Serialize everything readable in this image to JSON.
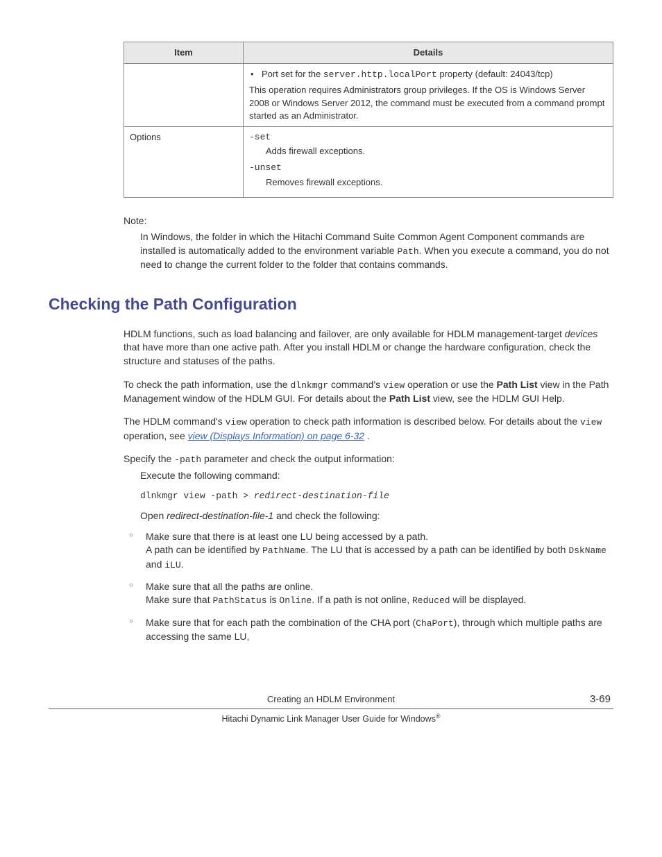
{
  "table": {
    "headers": {
      "item": "Item",
      "details": "Details"
    },
    "row1": {
      "bullet_pre": "Port set for the ",
      "bullet_code": "server.http.localPort",
      "bullet_post": " property (default: 24043/tcp)",
      "para": "This operation requires Administrators group privileges. If the OS is Windows Server 2008 or Windows Server 2012, the command must be executed from a command prompt started as an Administrator."
    },
    "row2": {
      "item": "Options",
      "opt1_code": "-set",
      "opt1_desc": "Adds firewall exceptions.",
      "opt2_code": "-unset",
      "opt2_desc": "Removes firewall exceptions."
    }
  },
  "note": {
    "label": "Note:",
    "body_pre": "In Windows, the folder in which the Hitachi Command Suite Common Agent Component commands are installed is automatically added to the environment variable ",
    "body_code": "Path",
    "body_post": ". When you execute a command, you do not need to change the current folder to the folder that contains commands."
  },
  "heading": "Checking the Path Configuration",
  "para1_pre": "HDLM functions, such as load balancing and failover, are only available for HDLM management-target ",
  "para1_em": "devices",
  "para1_post": " that have more than one active path. After you install HDLM or change the hardware configuration, check the structure and statuses of the paths.",
  "para2": {
    "t1": "To check the path information, use the ",
    "c1": "dlnkmgr",
    "t2": " command's ",
    "c2": "view",
    "t3": " operation or use the ",
    "b1": "Path List",
    "t4": " view in the Path Management window of the HDLM GUI. For details about the ",
    "b2": "Path List",
    "t5": " view, see the HDLM GUI Help."
  },
  "para3": {
    "t1": "The HDLM command's ",
    "c1": "view",
    "t2": " operation to check path information is described below. For details about the ",
    "c2": "view",
    "t3": " operation, see ",
    "link": "view (Displays Information) on page 6-32",
    "t4": " ."
  },
  "para4": {
    "t1": "Specify the ",
    "c1": "-path",
    "t2": " parameter and check the output information:"
  },
  "sub1": "Execute the following command:",
  "cmd": {
    "t1": "dlnkmgr view -path > ",
    "it": "redirect-destination-file"
  },
  "sub2": {
    "t1": "Open ",
    "it": "redirect-destination-file-1",
    "t2": " and check the following:"
  },
  "bullets": {
    "b1": {
      "l1": "Make sure that there is at least one LU being accessed by a path.",
      "l2_t1": "A path can be identified by ",
      "l2_c1": "PathName",
      "l2_t2": ". The LU that is accessed by a path can be identified by both ",
      "l2_c2": "DskName",
      "l2_t3": " and ",
      "l2_c3": "iLU",
      "l2_t4": "."
    },
    "b2": {
      "l1": "Make sure that all the paths are online.",
      "l2_t1": "Make sure that ",
      "l2_c1": "PathStatus",
      "l2_t2": " is ",
      "l2_c2": "Online",
      "l2_t3": ". If a path is not online, ",
      "l2_c3": "Reduced",
      "l2_t4": " will be displayed."
    },
    "b3": {
      "t1": "Make sure that for each path the combination of the CHA port (",
      "c1": "ChaPort",
      "t2": "), through which multiple paths are accessing the same LU,"
    }
  },
  "footer": {
    "chapter": "Creating an HDLM Environment",
    "page": "3-69",
    "book_pre": "Hitachi Dynamic Link Manager User Guide for Windows",
    "reg": "®"
  }
}
